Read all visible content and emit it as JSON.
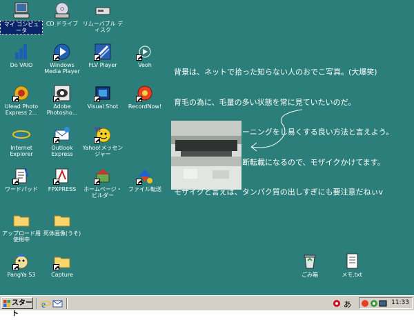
{
  "desktop": {
    "icons": [
      {
        "label": "マイ コンピュータ",
        "icon": "my-computer-icon"
      },
      {
        "label": "Do VAIO",
        "icon": "do-vaio-icon"
      },
      {
        "label": "Ulead Photo Express 2...",
        "icon": "ulead-photo-express-icon"
      },
      {
        "label": "Internet Explorer",
        "icon": "internet-explorer-icon"
      },
      {
        "label": "ワードパッド",
        "icon": "wordpad-icon"
      },
      {
        "label": "アップロード用 使用中",
        "icon": "folder-icon"
      },
      {
        "label": "PangYa S3",
        "icon": "pangya-icon"
      },
      {
        "label": "CD ドライブ",
        "icon": "cd-drive-icon"
      },
      {
        "label": "Windows Media Player",
        "icon": "windows-media-player-icon"
      },
      {
        "label": "Adobe Photosho...",
        "icon": "adobe-photoshop-icon"
      },
      {
        "label": "Outlook Express",
        "icon": "outlook-express-icon"
      },
      {
        "label": "FPXPRESS",
        "icon": "fpxpress-icon"
      },
      {
        "label": "死体画像(うそ)",
        "icon": "folder-icon"
      },
      {
        "label": "Capture",
        "icon": "folder-icon"
      },
      {
        "label": "リムーバブル ディスク",
        "icon": "removable-disk-icon"
      },
      {
        "label": "FLV Player",
        "icon": "flv-player-icon"
      },
      {
        "label": "Visual Shot",
        "icon": "visual-shot-icon"
      },
      {
        "label": "Yahoo!メッセンジャー",
        "icon": "yahoo-messenger-icon"
      },
      {
        "label": "ホームページ・ビルダー",
        "icon": "homepage-builder-icon"
      },
      {
        "label": "Veoh",
        "icon": "veoh-icon"
      },
      {
        "label": "RecordNow!",
        "icon": "recordnow-icon"
      },
      {
        "label": "ファイル転送",
        "icon": "file-transfer-icon"
      },
      {
        "label": "ごみ箱",
        "icon": "recycle-bin-icon"
      },
      {
        "label": "メモ.txt",
        "icon": "text-file-icon"
      }
    ]
  },
  "note": {
    "lines": [
      "背景は、ネットで拾った知らない人のおでこ写真。(大爆笑)",
      "育毛の為に、毛量の多い状態を常に見ていたいのだ。",
      "これはイメージトレーニングをし易くする良い方法と言えよう。",
      "そのまま載せると無断転載になるので、モザイクかけてます。",
      "モザイクと言えば、タンパク質の出しすぎにも要注意だねぃv"
    ]
  },
  "taskbar": {
    "start_label": "スタート",
    "ime_label": "あ",
    "clock": "11:33"
  },
  "colors": {
    "desktop": "#2b7e79",
    "taskbar": "#d4d0c8",
    "selection": "#0a246a"
  }
}
